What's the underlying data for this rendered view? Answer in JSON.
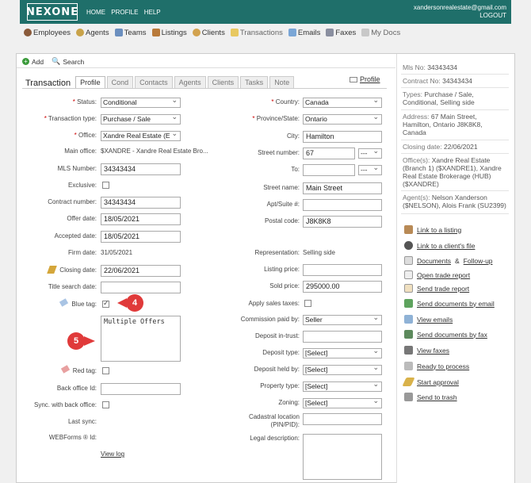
{
  "header": {
    "logo": "NEXONE",
    "nav": [
      "HOME",
      "PROFILE",
      "HELP"
    ],
    "user_email": "xandersonrealestate@gmail.com",
    "logout": "LOGOUT",
    "brand_color": "#1f6f6a"
  },
  "main_nav": [
    {
      "label": "Employees",
      "icon": "people-icon"
    },
    {
      "label": "Agents",
      "icon": "agents-icon"
    },
    {
      "label": "Teams",
      "icon": "teams-icon"
    },
    {
      "label": "Listings",
      "icon": "listings-icon"
    },
    {
      "label": "Clients",
      "icon": "clients-icon"
    },
    {
      "label": "Transactions",
      "icon": "folder-icon"
    },
    {
      "label": "Emails",
      "icon": "email-icon"
    },
    {
      "label": "Faxes",
      "icon": "fax-icon"
    },
    {
      "label": "My Docs",
      "icon": "docs-icon"
    }
  ],
  "toolbar": {
    "add": "Add",
    "search": "Search"
  },
  "tabs": {
    "title": "Transaction",
    "items": [
      "Profile",
      "Cond",
      "Contacts",
      "Agents",
      "Clients",
      "Tasks",
      "Note"
    ],
    "profile_link": "Profile"
  },
  "left": {
    "status": {
      "label": "Status:",
      "value": "Conditional"
    },
    "transaction_type": {
      "label": "Transaction type:",
      "value": "Purchase / Sale"
    },
    "office": {
      "label": "Office:",
      "value": "Xandre Real Estate (E"
    },
    "main_office": {
      "label": "Main office:",
      "value": "$XANDRE - Xandre Real Estate Bro..."
    },
    "mls_number": {
      "label": "MLS Number:",
      "value": "34343434"
    },
    "exclusive": {
      "label": "Exclusive:"
    },
    "contract_number": {
      "label": "Contract number:",
      "value": "34343434"
    },
    "offer_date": {
      "label": "Offer date:",
      "value": "18/05/2021"
    },
    "accepted_date": {
      "label": "Accepted date:",
      "value": "18/05/2021"
    },
    "firm_date": {
      "label": "Firm date:",
      "value": "31/05/2021"
    },
    "closing_date": {
      "label": "Closing date:",
      "value": "22/06/2021"
    },
    "title_search_date": {
      "label": "Title search date:",
      "value": ""
    },
    "blue_tag": {
      "label": "Blue tag:",
      "checked": true
    },
    "notes": {
      "value": "Multiple Offers"
    },
    "red_tag": {
      "label": "Red tag:"
    },
    "back_office_id": {
      "label": "Back office Id:",
      "value": ""
    },
    "sync": {
      "label": "Sync. with back office:"
    },
    "last_sync": {
      "label": "Last sync:"
    },
    "webforms": {
      "label": "WEBForms ® Id:"
    },
    "view_log": "View log"
  },
  "right": {
    "country": {
      "label": "Country:",
      "value": "Canada"
    },
    "province": {
      "label": "Province/State:",
      "value": "Ontario"
    },
    "city": {
      "label": "City:",
      "value": "Hamilton"
    },
    "street_number": {
      "label": "Street number:",
      "value": "67",
      "suffix": "---"
    },
    "to": {
      "label": "To:",
      "value": "",
      "suffix": "---"
    },
    "street_name": {
      "label": "Street name:",
      "value": "Main Street"
    },
    "apt": {
      "label": "Apt/Suite #:",
      "value": ""
    },
    "postal_code": {
      "label": "Postal code:",
      "value": "J8K8K8"
    },
    "representation": {
      "label": "Representation:",
      "value": "Selling side"
    },
    "listing_price": {
      "label": "Listing price:",
      "value": ""
    },
    "sold_price": {
      "label": "Sold price:",
      "value": "295000.00"
    },
    "apply_taxes": {
      "label": "Apply sales taxes:"
    },
    "commission_paid_by": {
      "label": "Commission paid by:",
      "value": "Seller"
    },
    "deposit_in_trust": {
      "label": "Deposit in-trust:",
      "value": ""
    },
    "deposit_type": {
      "label": "Deposit type:",
      "value": "[Select]"
    },
    "deposit_held_by": {
      "label": "Deposit held by:",
      "value": "[Select]"
    },
    "property_type": {
      "label": "Property type:",
      "value": "[Select]"
    },
    "zoning": {
      "label": "Zoning:",
      "value": "[Select]"
    },
    "cadastral": {
      "label1": "Cadastral location",
      "label2": "(PIN/PID):",
      "value": ""
    },
    "legal_description": {
      "label": "Legal description:",
      "value": ""
    }
  },
  "callouts": {
    "four": "4",
    "five": "5",
    "color": "#e03a3a"
  },
  "sidebar": {
    "mls": {
      "k": "Mls No:",
      "v": "34343434"
    },
    "contract": {
      "k": "Contract No:",
      "v": "34343434"
    },
    "types": {
      "k": "Types:",
      "v1": "Purchase / Sale,",
      "v2": "Conditional, Selling side"
    },
    "address": {
      "k": "Address:",
      "v1": "67 Main Street,",
      "v2": "Hamilton, Ontario J8K8K8,",
      "v3": "Canada"
    },
    "closing": {
      "k": "Closing date:",
      "v": "22/06/2021"
    },
    "offices": {
      "k": "Office(s):",
      "v1": "Xandre Real Estate",
      "v2": "(Branch 1) ($XANDRE1), Xandre",
      "v3": "Real Estate Brokerage (HUB)",
      "v4": "($XANDRE)"
    },
    "agents": {
      "k": "Agent(s):",
      "v1": "Nelson Xanderson",
      "v2": "($NELSON), Alois Frank (SU2399)"
    },
    "actions": [
      {
        "label": "Link to a listing",
        "icon": "house-icon"
      },
      {
        "label": "Link to a client's file",
        "icon": "person-icon"
      },
      {
        "label": "Documents",
        "sep": "&",
        "label2": "Follow-up",
        "icon": "documents-icon"
      },
      {
        "label": "Open trade report",
        "icon": "report-icon"
      },
      {
        "label": "Send trade report",
        "icon": "send-report-icon"
      },
      {
        "label": "Send documents by email",
        "icon": "email-icon"
      },
      {
        "label": "View emails",
        "icon": "inbox-icon"
      },
      {
        "label": "Send documents by fax",
        "icon": "fax-icon"
      },
      {
        "label": "View faxes",
        "icon": "view-fax-icon"
      },
      {
        "label": "Ready to process",
        "icon": "process-icon"
      },
      {
        "label": "Start approval",
        "icon": "pen-icon"
      },
      {
        "label": "Send to trash",
        "icon": "trash-icon"
      }
    ]
  }
}
